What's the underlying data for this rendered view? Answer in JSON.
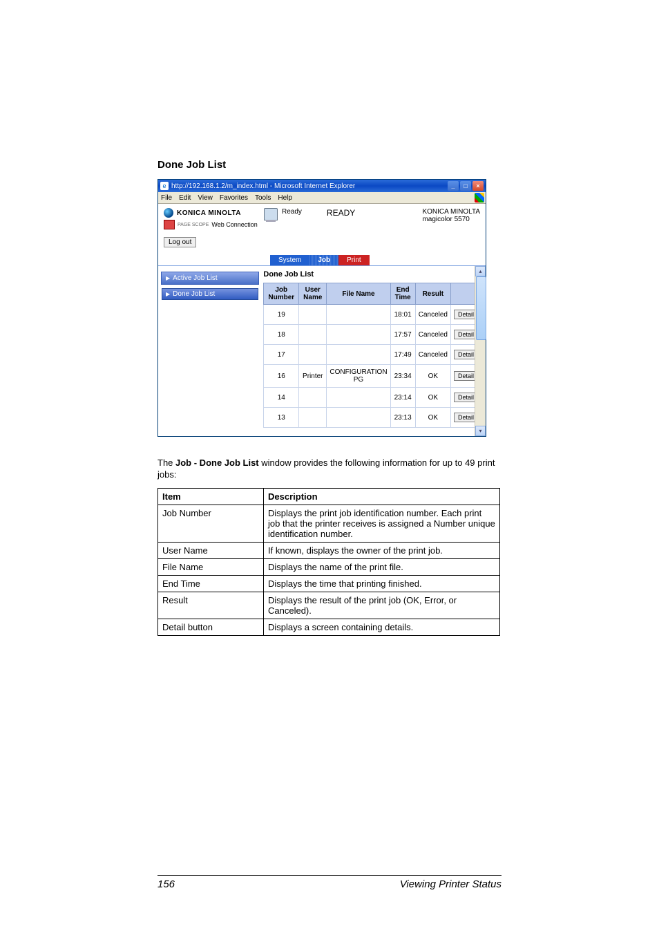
{
  "section_heading": "Done Job List",
  "browser": {
    "title": "http://192.168.1.2/m_index.html - Microsoft Internet Explorer",
    "menu": [
      "File",
      "Edit",
      "View",
      "Favorites",
      "Tools",
      "Help"
    ]
  },
  "header": {
    "brand": "KONICA MINOLTA",
    "subbrand_prefix": "PAGE SCOPE",
    "subbrand": "Web Connection",
    "status_small": "Ready",
    "status_big": "READY",
    "device_line1": "KONICA MINOLTA",
    "device_line2": "magicolor 5570"
  },
  "logout_label": "Log out",
  "tabs": {
    "system": "System",
    "job": "Job",
    "print": "Print"
  },
  "sidebar": {
    "active": "Active Job List",
    "done": "Done Job List"
  },
  "pane": {
    "title": "Done Job List",
    "columns": {
      "job_number": "Job Number",
      "user_name": "User Name",
      "file_name": "File Name",
      "end_time": "End Time",
      "result": "Result",
      "detail": ""
    },
    "detail_label": "Detail",
    "rows": [
      {
        "num": "19",
        "user": "",
        "file": "",
        "end": "18:01",
        "result": "Canceled"
      },
      {
        "num": "18",
        "user": "",
        "file": "",
        "end": "17:57",
        "result": "Canceled"
      },
      {
        "num": "17",
        "user": "",
        "file": "",
        "end": "17:49",
        "result": "Canceled"
      },
      {
        "num": "16",
        "user": "Printer",
        "file": "CONFIGURATION PG",
        "end": "23:34",
        "result": "OK"
      },
      {
        "num": "14",
        "user": "",
        "file": "",
        "end": "23:14",
        "result": "OK"
      },
      {
        "num": "13",
        "user": "",
        "file": "",
        "end": "23:13",
        "result": "OK"
      }
    ]
  },
  "description": {
    "prefix": "The ",
    "bold": "Job - Done Job List",
    "suffix": " window provides the following information for up to 49 print jobs:"
  },
  "info": {
    "headers": {
      "item": "Item",
      "desc": "Description"
    },
    "rows": [
      {
        "item": "Job Number",
        "desc": "Displays the print job identification number. Each print job that the printer receives is assigned a Number unique identification number."
      },
      {
        "item": "User Name",
        "desc": "If known, displays the owner of the print job."
      },
      {
        "item": "File Name",
        "desc": "Displays the name of the print file."
      },
      {
        "item": "End Time",
        "desc": "Displays the time that printing finished."
      },
      {
        "item": "Result",
        "desc": "Displays the result of the print job (OK, Error, or Canceled)."
      },
      {
        "item": "Detail button",
        "desc": "Displays a screen containing details."
      }
    ]
  },
  "footer": {
    "page": "156",
    "title": "Viewing Printer Status"
  }
}
